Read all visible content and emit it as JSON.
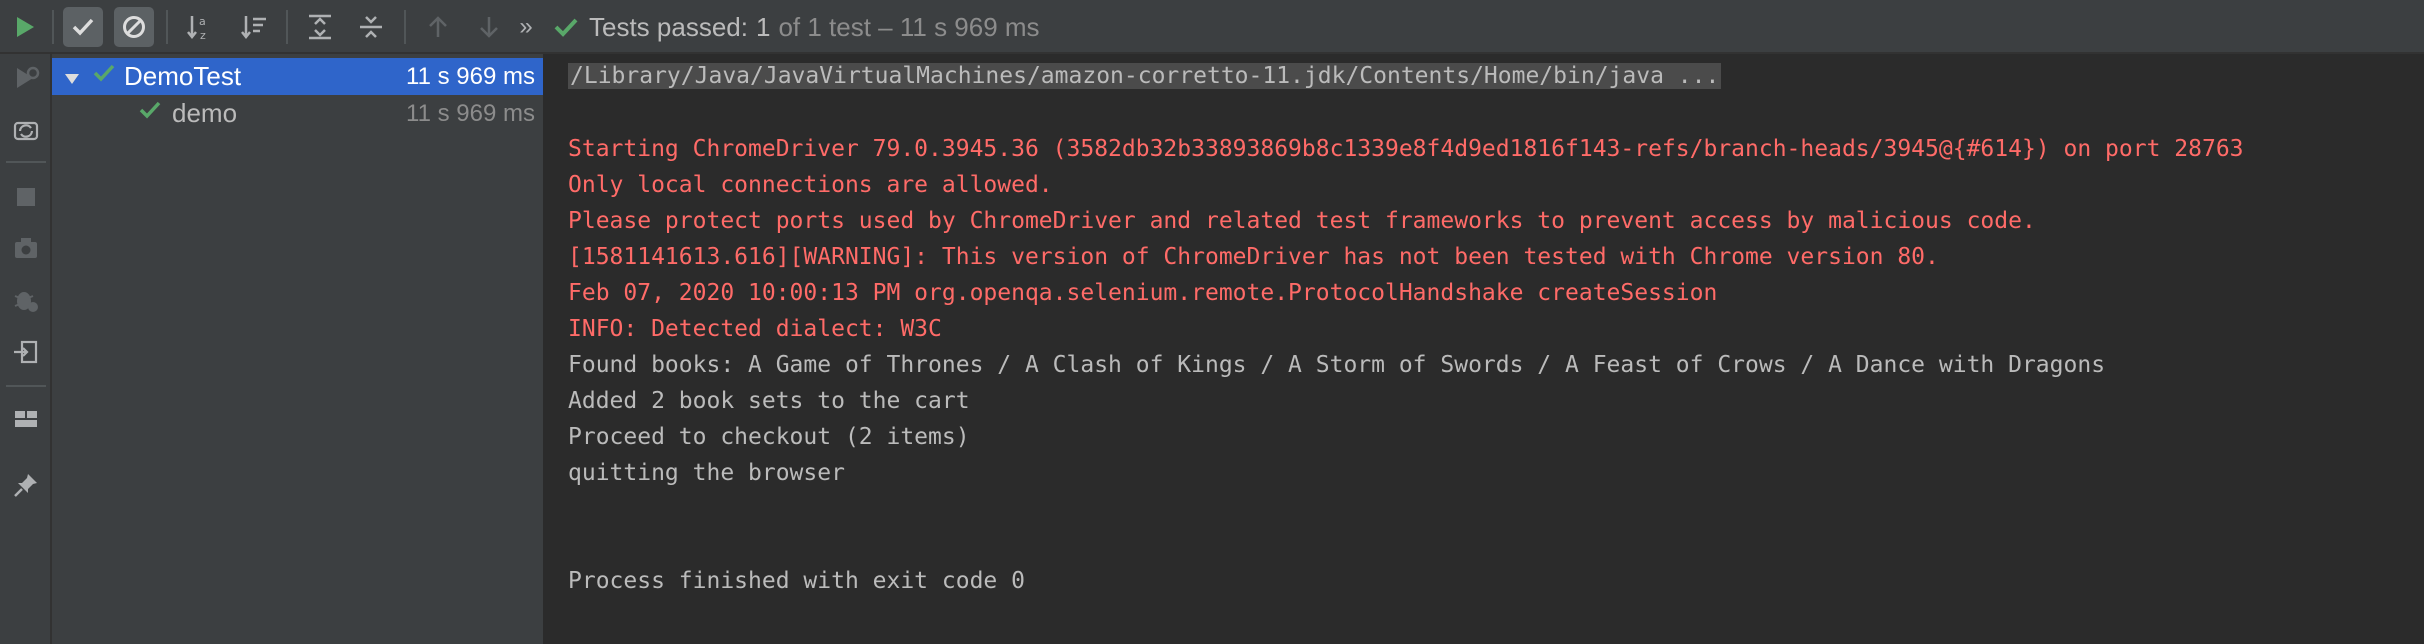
{
  "toolbar": {
    "status_prefix": "Tests passed:",
    "status_passed": "1",
    "status_detail": "of 1 test – 11 s 969 ms"
  },
  "tree": {
    "rows": [
      {
        "label": "DemoTest",
        "duration": "11 s 969 ms",
        "selected": true
      },
      {
        "label": "demo",
        "duration": "11 s 969 ms",
        "selected": false
      }
    ]
  },
  "console": {
    "command": "/Library/Java/JavaVirtualMachines/amazon-corretto-11.jdk/Contents/Home/bin/java ...",
    "lines": [
      "Starting ChromeDriver 79.0.3945.36 (3582db32b33893869b8c1339e8f4d9ed1816f143-refs/branch-heads/3945@{#614}) on port 28763",
      "Only local connections are allowed.",
      "Please protect ports used by ChromeDriver and related test frameworks to prevent access by malicious code.",
      "[1581141613.616][WARNING]: This version of ChromeDriver has not been tested with Chrome version 80.",
      "Feb 07, 2020 10:00:13 PM org.openqa.selenium.remote.ProtocolHandshake createSession",
      "INFO: Detected dialect: W3C",
      "Found books: A Game of Thrones / A Clash of Kings / A Storm of Swords / A Feast of Crows / A Dance with Dragons",
      "Added 2 book sets to the cart",
      "Proceed to checkout (2 items)",
      "quitting the browser",
      "Process finished with exit code 0"
    ]
  },
  "colors": {
    "accent_green": "#59a869",
    "error_red": "#ff6b68",
    "selection_blue": "#2f65ca",
    "panel": "#3c3f41",
    "editor": "#2b2b2b"
  }
}
